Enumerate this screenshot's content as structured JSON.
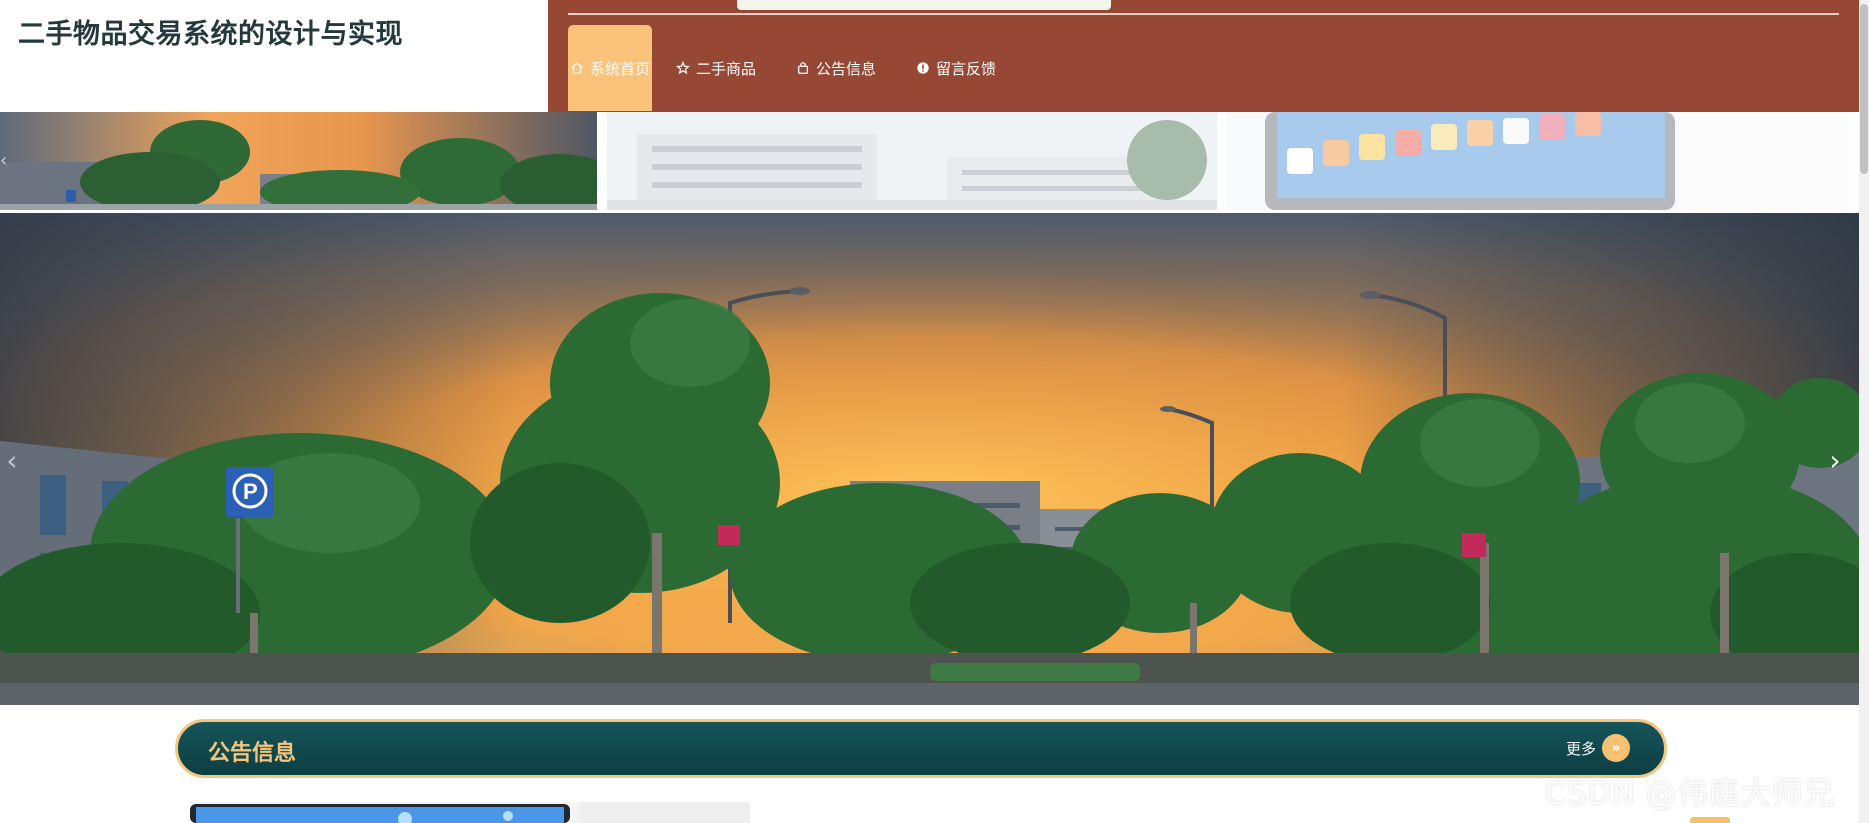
{
  "site": {
    "title": "二手物品交易系统的设计与实现"
  },
  "nav": {
    "items": [
      {
        "label": "系统首页",
        "icon": "home-icon",
        "active": true
      },
      {
        "label": "二手商品",
        "icon": "star-icon",
        "active": false
      },
      {
        "label": "公告信息",
        "icon": "bag-icon",
        "active": false
      },
      {
        "label": "留言反馈",
        "icon": "info-icon",
        "active": false
      }
    ]
  },
  "carousel": {
    "prev_icon": "chevron-left-icon",
    "next_icon": "chevron-right-icon",
    "slides": [
      {
        "subject": "campus sunset",
        "icon": "image-icon"
      },
      {
        "subject": "campus buildings",
        "icon": "image-icon"
      },
      {
        "subject": "tablet device",
        "icon": "image-icon"
      }
    ]
  },
  "notice": {
    "title": "公告信息",
    "more_label": "更多",
    "more_icon": "double-chevron-right-icon"
  },
  "watermark": {
    "text": "CSDN @伟庭大师兄"
  },
  "colors": {
    "nav_background": "#974834",
    "nav_active": "#fbc27b",
    "notice_bar": "#12474c",
    "notice_accent": "#f4c77e",
    "title_text": "#25393d"
  }
}
